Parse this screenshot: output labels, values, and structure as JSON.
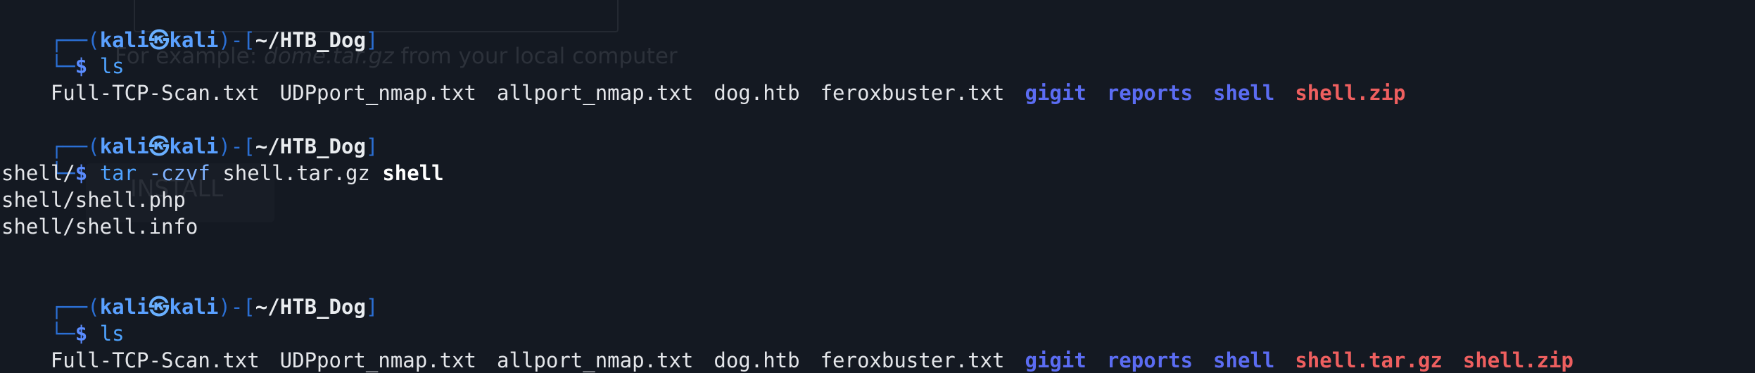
{
  "terminal": {
    "prompt": {
      "frame_top_open": "┌──(",
      "user": "kali",
      "at_symbol": "㉿",
      "host": "kali",
      "frame_mid": ")-[",
      "path": "~/HTB_Dog",
      "frame_close": "]",
      "frame_bottom": "└─",
      "dollar": "$"
    },
    "blocks": [
      {
        "command": {
          "name": "ls",
          "args": "",
          "target": ""
        },
        "files": [
          {
            "name": "Full-TCP-Scan.txt",
            "kind": "plain"
          },
          {
            "name": "UDPport_nmap.txt",
            "kind": "plain"
          },
          {
            "name": "allport_nmap.txt",
            "kind": "plain"
          },
          {
            "name": "dog.htb",
            "kind": "plain"
          },
          {
            "name": "feroxbuster.txt",
            "kind": "plain"
          },
          {
            "name": "gigit",
            "kind": "dir"
          },
          {
            "name": "reports",
            "kind": "dir"
          },
          {
            "name": "shell",
            "kind": "dir"
          },
          {
            "name": "shell.zip",
            "kind": "archive"
          }
        ]
      },
      {
        "command": {
          "name": "tar",
          "args": "-czvf",
          "target": "shell.tar.gz",
          "target_bold": "shell"
        },
        "output": [
          "shell/",
          "shell/shell.php",
          "shell/shell.info"
        ]
      },
      {
        "command": {
          "name": "ls",
          "args": "",
          "target": ""
        },
        "files": [
          {
            "name": "Full-TCP-Scan.txt",
            "kind": "plain"
          },
          {
            "name": "UDPport_nmap.txt",
            "kind": "plain"
          },
          {
            "name": "allport_nmap.txt",
            "kind": "plain"
          },
          {
            "name": "dog.htb",
            "kind": "plain"
          },
          {
            "name": "feroxbuster.txt",
            "kind": "plain"
          },
          {
            "name": "gigit",
            "kind": "dir"
          },
          {
            "name": "reports",
            "kind": "dir"
          },
          {
            "name": "shell",
            "kind": "dir"
          },
          {
            "name": "shell.tar.gz",
            "kind": "archive"
          },
          {
            "name": "shell.zip",
            "kind": "archive"
          }
        ]
      }
    ]
  },
  "background_window": {
    "hint_prefix": "For example: ",
    "hint_emphasis": "dome.tar.gz",
    "hint_suffix": " from your local computer",
    "install_button": "INSTALL"
  },
  "colors": {
    "background": "#141922",
    "directory": "#5b6cf2",
    "archive": "#ee5f5f",
    "prompt_frame": "#2b6fd4"
  }
}
